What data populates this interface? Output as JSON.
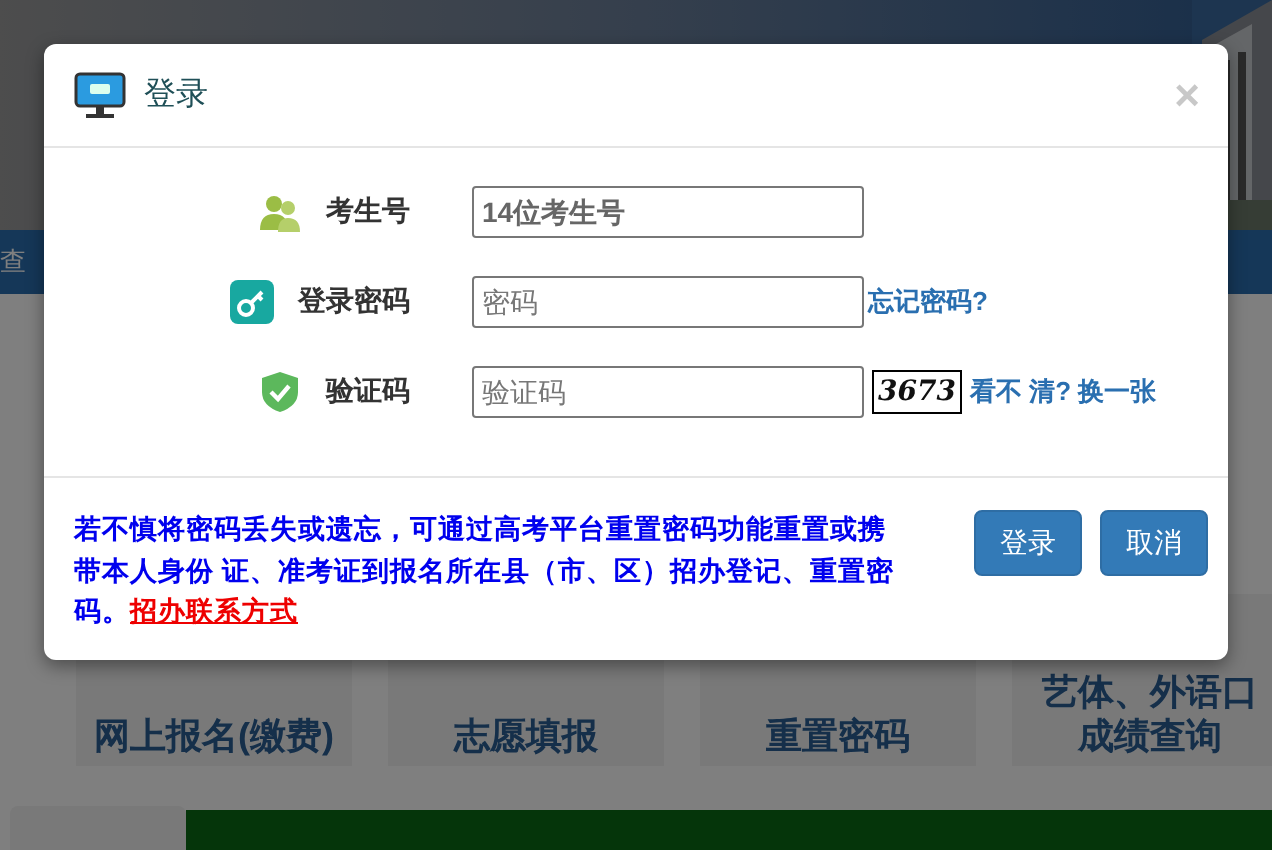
{
  "background": {
    "nav_text": "查",
    "tiles": [
      {
        "lines": [
          "网上报名(缴费)"
        ]
      },
      {
        "lines": [
          "志愿填报"
        ]
      },
      {
        "lines": [
          "重置密码"
        ]
      },
      {
        "lines": [
          "艺体、外语口",
          "成绩查询"
        ]
      }
    ]
  },
  "dialog": {
    "title": "登录",
    "close": "×",
    "fields": [
      {
        "kind": "text",
        "label": "考生号",
        "placeholder": "14位考生号"
      },
      {
        "kind": "password",
        "label": "登录密码",
        "placeholder": "密码",
        "link": "忘记密码?"
      },
      {
        "kind": "captcha",
        "label": "验证码",
        "placeholder": "验证码",
        "captcha": "3673",
        "link": "看不 清? 换一张"
      }
    ],
    "notice": {
      "text": "若不慎将密码丢失或遗忘，可通过高考平台重置密码功能重置或携带本人身份 证、准考证到报名所在县（市、区）招办登记、重置密码。",
      "link": "招办联系方式"
    },
    "buttons": [
      "登录",
      "取消"
    ]
  }
}
